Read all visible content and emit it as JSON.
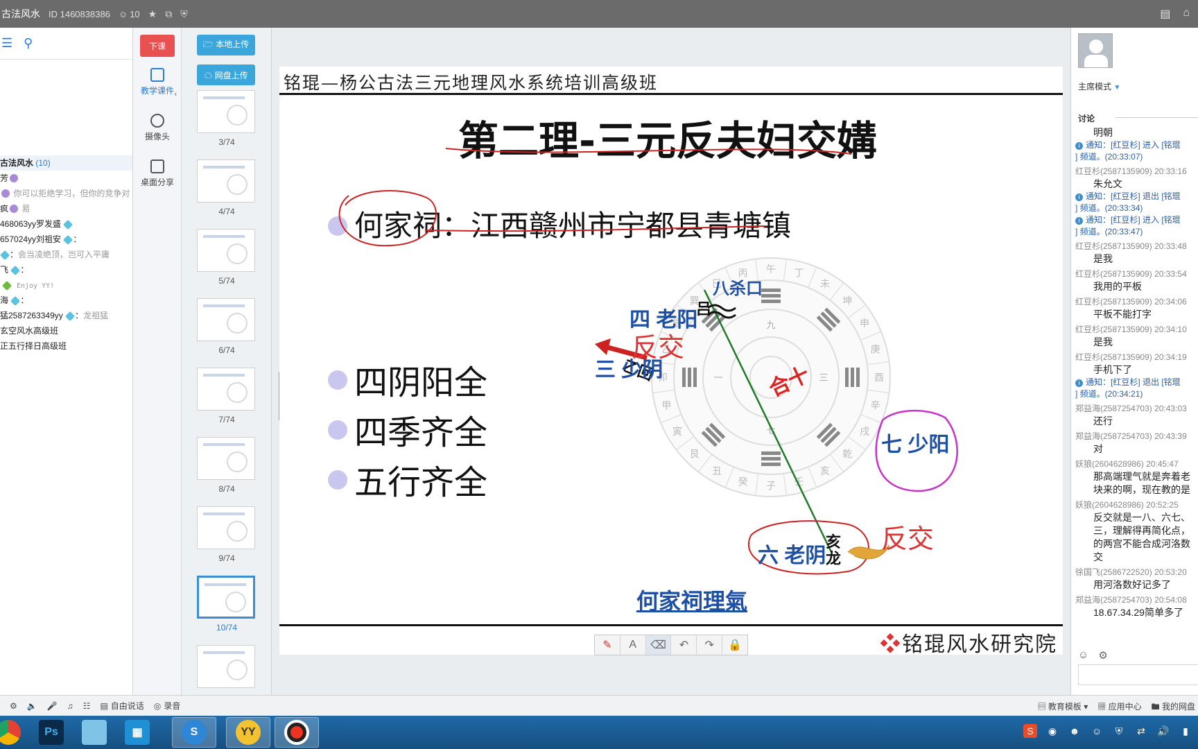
{
  "titlebar": {
    "channel_name": "古法风水",
    "room_id": "ID 1460838386",
    "online_count": "10"
  },
  "channel_tree": {
    "root_name": "古法风水",
    "root_count": "(10)",
    "rows": [
      {
        "name": "芳",
        "note": ""
      },
      {
        "name": "",
        "note": "你可以拒绝学习，但你的竞争对"
      },
      {
        "name": "疯",
        "note": "易"
      },
      {
        "name": "468063yy罗发盛",
        "note": ""
      },
      {
        "name": "657024yy刘祖安",
        "note": ""
      },
      {
        "name": "",
        "note": "会当凌绝顶，岂可入平庸"
      },
      {
        "name": "飞",
        "note": ""
      },
      {
        "name": "",
        "note": "Enjoy YY!"
      },
      {
        "name": "海",
        "note": ""
      },
      {
        "name": "猛2587263349yy",
        "note": "龙祖猛"
      }
    ],
    "subchannels": [
      "玄空风水高级班",
      "正五行择日高级班"
    ]
  },
  "funcbar": {
    "end_class": "下课",
    "courseware": "教学课件",
    "camera": "摄像头",
    "desktop_share": "桌面分享"
  },
  "upload": {
    "local": "本地上传",
    "cloud": "网盘上传"
  },
  "thumbnails": [
    {
      "num": "3/74",
      "active": false
    },
    {
      "num": "4/74",
      "active": false
    },
    {
      "num": "5/74",
      "active": false
    },
    {
      "num": "6/74",
      "active": false
    },
    {
      "num": "7/74",
      "active": false
    },
    {
      "num": "8/74",
      "active": false
    },
    {
      "num": "9/74",
      "active": false
    },
    {
      "num": "10/74",
      "active": true
    },
    {
      "num": "",
      "active": false
    }
  ],
  "slide": {
    "banner": "铭琨—杨公古法三元地理风水系统培训高级班",
    "title": "第二理-三元反夫妇交媾",
    "location": "何家祠：江西赣州市宁都县青塘镇",
    "points": [
      "四阴阳全",
      "四季齐全",
      "五行齐全"
    ],
    "caption": "何家祠理氣",
    "brand": "铭琨风水研究院",
    "diagram": {
      "label_bsk": "八杀口",
      "label_4": "四 老阳",
      "label_3": "三 少阴",
      "label_7": "七 少阳",
      "label_6": "六 老阴",
      "center": "合十",
      "fanjiao": "反交",
      "hailong": "亥龙",
      "lv": "吕",
      "yiqi": "乙回",
      "ring_inner": [
        "九",
        "三",
        "七",
        "一"
      ],
      "ring_outer": [
        "午",
        "丁",
        "未",
        "坤",
        "申",
        "庚",
        "酉",
        "辛",
        "戌",
        "乾",
        "亥",
        "壬",
        "子",
        "癸",
        "丑",
        "艮",
        "寅",
        "甲",
        "卯",
        "乙",
        "辰",
        "巽",
        "巳",
        "丙"
      ]
    }
  },
  "drawbar": [
    "pen",
    "text",
    "eraser",
    "undo",
    "redo",
    "lock"
  ],
  "chat": {
    "mode": "主席模式",
    "discussion": "讨论",
    "messages": [
      {
        "type": "body",
        "text": "明朝"
      },
      {
        "type": "notice",
        "text": "通知：[红豆杉] 进入 [铭琨"
      },
      {
        "type": "notice2",
        "text": "] 频道。(20:33:07)"
      },
      {
        "type": "meta",
        "text": "红豆杉(2587135909) 20:33:16"
      },
      {
        "type": "body",
        "text": "朱允文"
      },
      {
        "type": "notice",
        "text": "通知：[红豆杉] 退出 [铭琨"
      },
      {
        "type": "notice2",
        "text": "] 频道。(20:33:34)"
      },
      {
        "type": "notice",
        "text": "通知：[红豆杉] 进入 [铭琨"
      },
      {
        "type": "notice2",
        "text": "] 频道。(20:33:47)"
      },
      {
        "type": "meta",
        "text": "红豆杉(2587135909) 20:33:48"
      },
      {
        "type": "body",
        "text": "是我"
      },
      {
        "type": "meta",
        "text": "红豆杉(2587135909) 20:33:54"
      },
      {
        "type": "body",
        "text": "我用的平板"
      },
      {
        "type": "meta",
        "text": "红豆杉(2587135909) 20:34:06"
      },
      {
        "type": "body",
        "text": "平板不能打字"
      },
      {
        "type": "meta",
        "text": "红豆杉(2587135909) 20:34:10"
      },
      {
        "type": "body",
        "text": "是我"
      },
      {
        "type": "meta",
        "text": "红豆杉(2587135909) 20:34:19"
      },
      {
        "type": "body",
        "text": "手机下了"
      },
      {
        "type": "notice",
        "text": "通知：[红豆杉] 退出 [铭琨"
      },
      {
        "type": "notice2",
        "text": "] 频道。(20:34:21)"
      },
      {
        "type": "meta",
        "text": "郑益海(2587254703) 20:43:03"
      },
      {
        "type": "body",
        "text": "还行"
      },
      {
        "type": "meta",
        "text": "郑益海(2587254703) 20:43:39"
      },
      {
        "type": "body",
        "text": "对"
      },
      {
        "type": "meta",
        "text": "妖狼(2604628986) 20:45:47"
      },
      {
        "type": "body",
        "text": "那高端理气就是奔着老"
      },
      {
        "type": "body",
        "text": "块来的啊，现在教的是"
      },
      {
        "type": "meta",
        "text": "妖狼(2604628986) 20:52:25"
      },
      {
        "type": "body",
        "text": "反交就是一八、六七、"
      },
      {
        "type": "body",
        "text": "三，理解得再简化点，"
      },
      {
        "type": "body",
        "text": "的两宫不能合成河洛数"
      },
      {
        "type": "body",
        "text": "交"
      },
      {
        "type": "meta",
        "text": "徐国飞(2586722520) 20:53:20"
      },
      {
        "type": "body",
        "text": "用河洛数好记多了"
      },
      {
        "type": "meta",
        "text": "郑益海(2587254703) 20:54:08"
      },
      {
        "type": "body",
        "text": "18.67.34.29简单多了"
      }
    ]
  },
  "statusbar": {
    "free_talk": "自由说话",
    "record": "录音",
    "edu_template": "教育模板",
    "app_center": "应用中心",
    "my_cloud": "我的网盘"
  },
  "taskbar": {
    "apps": [
      "chrome-app",
      "photoshop-app",
      "notepad-app",
      "explorer-app",
      "sogou-app",
      "yy-app",
      "recorder-app"
    ],
    "ps_label": "Ps"
  }
}
